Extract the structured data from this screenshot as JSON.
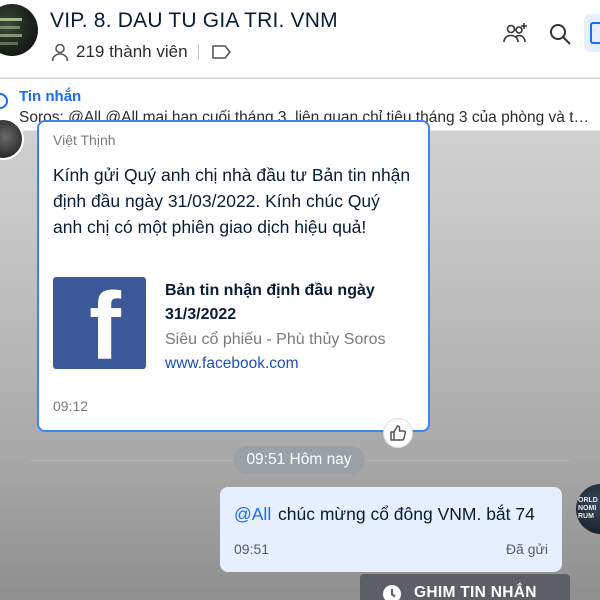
{
  "header": {
    "group_name": "VIP. 8. DAU TU GIA TRI. VNM",
    "member_count": "219 thành viên"
  },
  "pinned": {
    "title": "Tin nhắn",
    "text": "Soros: @All @All mai hạn cuối tháng 3. liên quan chỉ tiêu tháng 3 của phòng và tea..."
  },
  "incoming": {
    "sender": "Việt Thịnh",
    "text": "Kính gửi Quý anh chị nhà đầu tư Bản tin nhận định đầu ngày 31/03/2022. Kính chúc Quý anh chị có một phiên giao dịch hiệu quả!",
    "link_title": "Bản tin nhận định đầu ngày 31/3/2022",
    "link_subtitle": "Siêu cổ phiếu - Phù thủy Soros",
    "link_url": "www.facebook.com",
    "fb_glyph": "f",
    "time": "09:12"
  },
  "date_divider": "09:51 Hôm nay",
  "outgoing": {
    "mention": "@All",
    "text": "chúc mừng cổ đông VNM. bắt 74",
    "time": "09:51",
    "status": "Đã gửi"
  },
  "avatar_right_text": "ORLD NOMI RUM",
  "pin_button_label": "GHIM TIN NHẮN",
  "colors": {
    "accent": "#1a6cf0",
    "card_border": "#3e82f7",
    "facebook": "#3b5998",
    "outgoing_bubble": "#e5efff"
  }
}
